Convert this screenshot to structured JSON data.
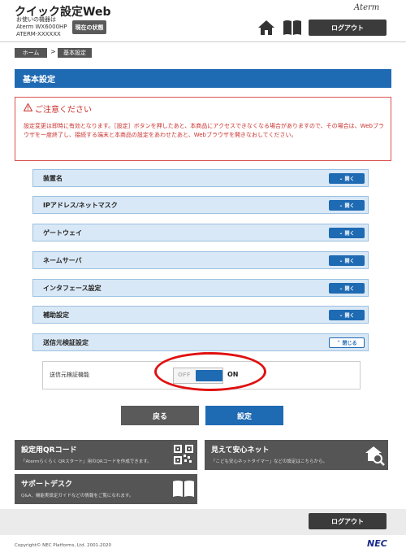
{
  "header": {
    "app_title": "クイック設定Web",
    "device_caption_1": "お使いの機器は",
    "device_caption_2": "Aterm WX6000HP",
    "device_caption_3": "ATERM-XXXXXX",
    "status_button": "現在の状態",
    "brand": "Aterm",
    "logout": "ログアウト"
  },
  "breadcrumb": {
    "home": "ホーム",
    "separator": ">",
    "current": "基本設定"
  },
  "page_title": "基本設定",
  "notice": {
    "title": "ご注意ください",
    "text": "設定変更は即時に有効となります。［設定］ボタンを押したあと、本商品にアクセスできなくなる場合がありますので、その場合は、Webブラウザを一度終了し、接続する端末と本商品の設定をあわせたあと、Webブラウザを開きなおしてください。"
  },
  "sections": [
    {
      "label": "装置名",
      "button": "開く"
    },
    {
      "label": "IPアドレス/ネットマスク",
      "button": "開く"
    },
    {
      "label": "ゲートウェイ",
      "button": "開く"
    },
    {
      "label": "ネームサーバ",
      "button": "開く"
    },
    {
      "label": "インタフェース設定",
      "button": "開く"
    },
    {
      "label": "補助設定",
      "button": "開く"
    },
    {
      "label": "送信元検証設定",
      "button": "閉じる"
    }
  ],
  "setting": {
    "label": "送信元検証機能",
    "off_label": "OFF",
    "on_label": "ON",
    "state": "ON"
  },
  "actions": {
    "back": "戻る",
    "apply": "設定"
  },
  "cards": {
    "qr": {
      "title": "設定用QRコード",
      "desc": "「Atermらくらく QRスタート」用のQRコードを作成できます。"
    },
    "safe": {
      "title": "見えて安心ネット",
      "desc": "「こども安心ネットタイマー」などの設定はこちらから。"
    },
    "support": {
      "title": "サポートデスク",
      "desc": "Q&A、機能実設定ガイドなどの情報をご覧になれます。"
    }
  },
  "footer": {
    "logout": "ログアウト",
    "copyright": "Copyright© NEC Platforms, Ltd. 2001-2020",
    "nec": "NEC"
  },
  "colors": {
    "accent": "#1e6ab3",
    "warning": "#c9302c",
    "highlight": "#e01010"
  }
}
